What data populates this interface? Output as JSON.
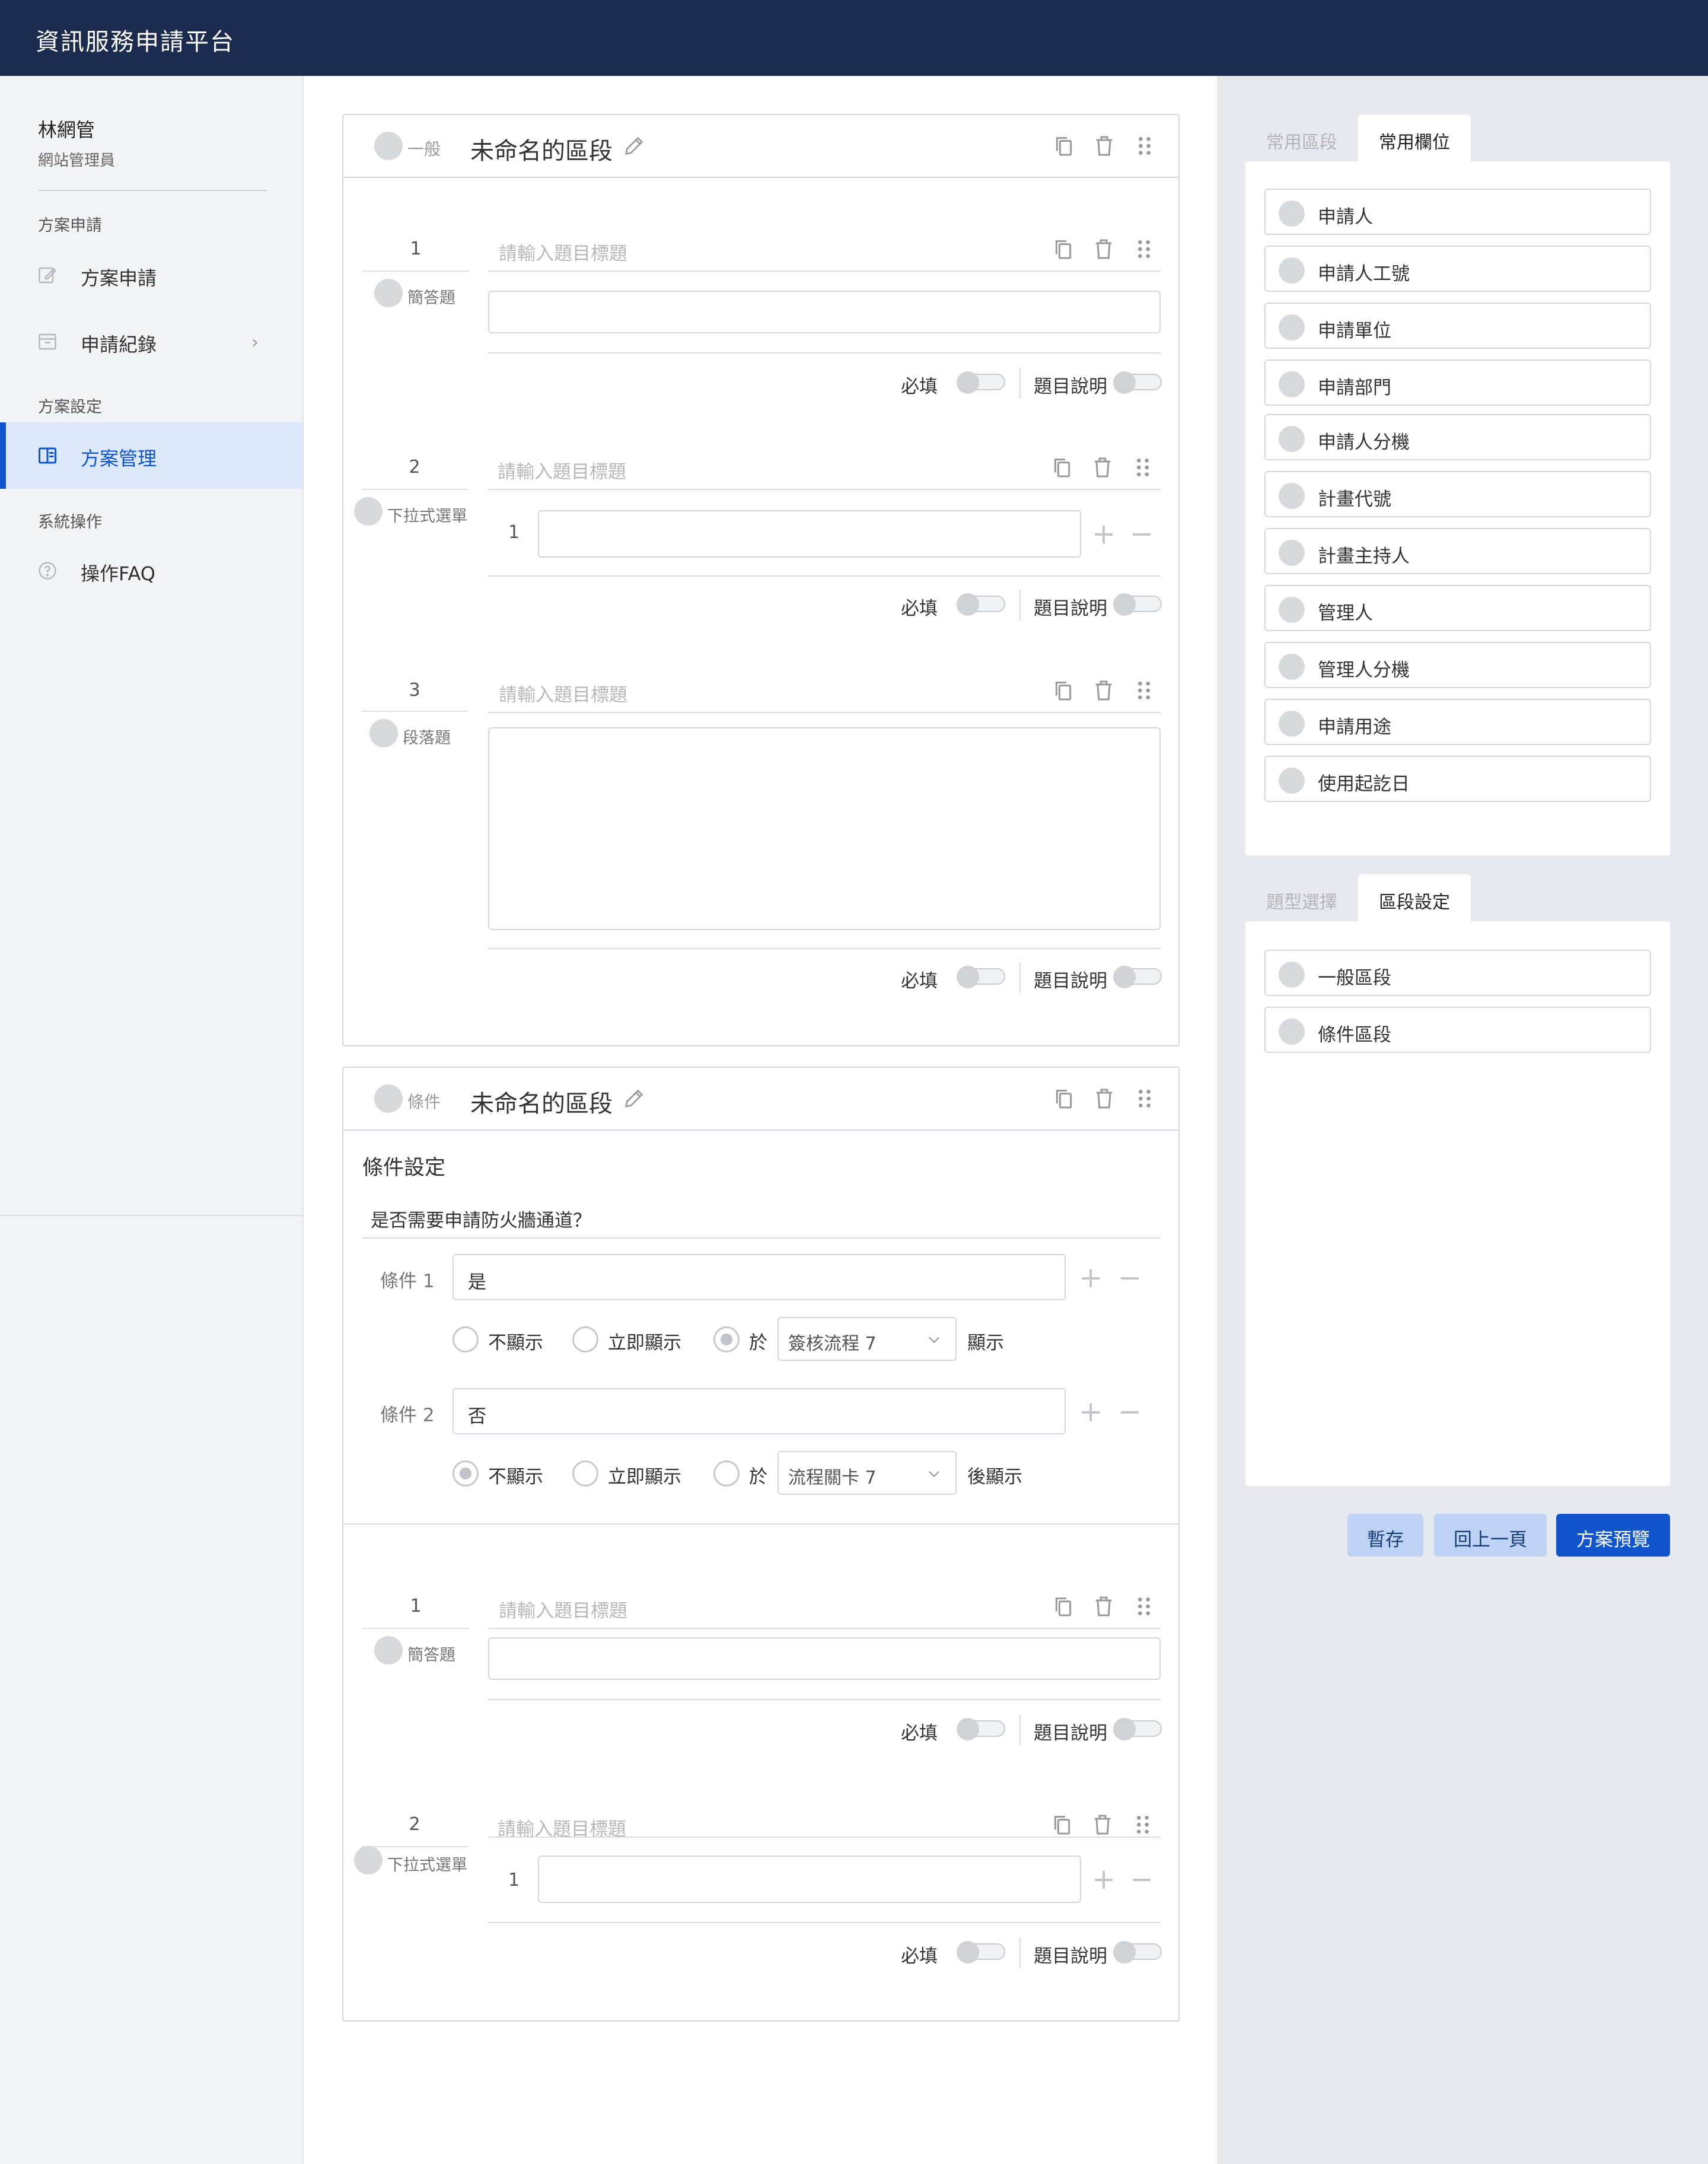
{
  "app": {
    "title": "資訊服務申請平台"
  },
  "user": {
    "name": "林網管",
    "role": "網站管理員"
  },
  "sidebar": {
    "sections": [
      {
        "label": "方案申請"
      },
      {
        "label": "方案設定"
      },
      {
        "label": "系統操作"
      }
    ],
    "items": [
      {
        "label": "方案申請",
        "icon": "edit-icon"
      },
      {
        "label": "申請紀錄",
        "icon": "inbox-icon",
        "arrow": "›"
      },
      {
        "label": "方案管理",
        "icon": "layout-icon",
        "active": true
      },
      {
        "label": "操作FAQ",
        "icon": "help-circle-icon"
      }
    ]
  },
  "common": {
    "required_label": "必填",
    "desc_label": "題目說明",
    "title_placeholder": "請輸入題目標題",
    "plus": "+",
    "minus": "−"
  },
  "section1": {
    "kind": "一般",
    "name": "未命名的區段",
    "questions": [
      {
        "num": "1",
        "type": "簡答題"
      },
      {
        "num": "2",
        "type": "下拉式選單",
        "option_num": "1"
      },
      {
        "num": "3",
        "type": "段落題"
      }
    ]
  },
  "section2": {
    "kind": "條件",
    "name": "未命名的區段",
    "cond_title": "條件設定",
    "cond_question": "是否需要申請防火牆通道？",
    "conditions": [
      {
        "label": "條件 1",
        "value": "是",
        "radios": [
          "不顯示",
          "立即顯示",
          "於"
        ],
        "selected": 2,
        "select_value": "簽核流程 7",
        "suffix": "顯示"
      },
      {
        "label": "條件 2",
        "value": "否",
        "radios": [
          "不顯示",
          "立即顯示",
          "於"
        ],
        "selected": 0,
        "select_value": "流程關卡 7",
        "suffix": "後顯示"
      }
    ],
    "questions": [
      {
        "num": "1",
        "type": "簡答題"
      },
      {
        "num": "2",
        "type": "下拉式選單",
        "option_num": "1"
      }
    ]
  },
  "right": {
    "tabs_top": [
      {
        "label": "常用區段",
        "active": false
      },
      {
        "label": "常用欄位",
        "active": true
      }
    ],
    "fields": [
      "申請人",
      "申請人工號",
      "申請單位",
      "申請部門",
      "申請人分機",
      "計畫代號",
      "計畫主持人",
      "管理人",
      "管理人分機",
      "申請用途",
      "使用起訖日"
    ],
    "tabs_bottom": [
      {
        "label": "題型選擇",
        "active": false
      },
      {
        "label": "區段設定",
        "active": true
      }
    ],
    "section_types": [
      "一般區段",
      "條件區段"
    ],
    "buttons": {
      "save": "暫存",
      "back": "回上一頁",
      "preview": "方案預覽"
    }
  }
}
